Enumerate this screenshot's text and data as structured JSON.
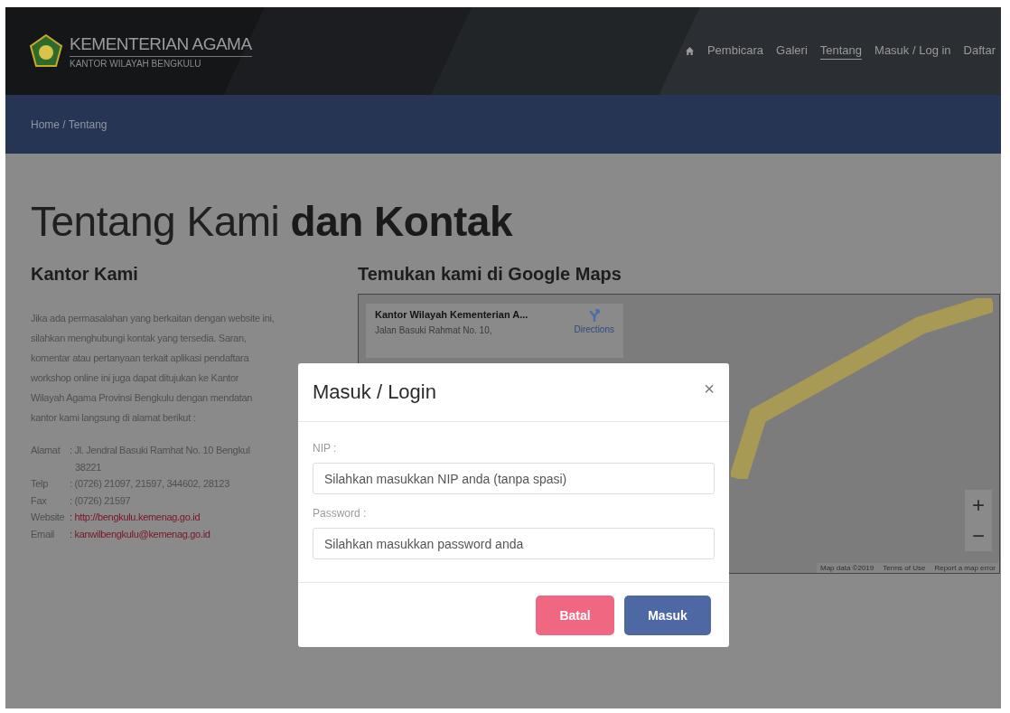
{
  "header": {
    "logo_title": "KEMENTERIAN AGAMA",
    "logo_subtitle": "KANTOR WILAYAH BENGKULU",
    "nav": [
      {
        "label": "Pembicara",
        "selected": false
      },
      {
        "label": "Galeri",
        "selected": false
      },
      {
        "label": "Tentang",
        "selected": true
      },
      {
        "label": "Masuk / Log in",
        "selected": false
      },
      {
        "label": "Daftar",
        "selected": false
      }
    ]
  },
  "breadcrumb": "Home / Tentang",
  "heading": "Tentang Kami **dan Kontak**",
  "office": {
    "title": "Kantor Kami",
    "paragraph_lines": [
      "Jika ada permasalahan yang berkaitan dengan website ini,",
      "silahkan menghubungi kontak yang tersedia. Saran,",
      "komentar atau pertanyaan terkait aplikasi pendaftara",
      "workshop online ini juga dapat ditujukan ke Kantor",
      "Wilayah Agama Provinsi Bengkulu dengan mendatan",
      "kantor kami langsung di alamat berikut :"
    ],
    "contacts": [
      {
        "label": "Alamat",
        "value": ": Jl. Jendral Basuki Ramhat No. 10 Bengkul",
        "value_2": "38221",
        "kind": "text"
      },
      {
        "label": "Telp",
        "value": ": (0726) 21097, 21597, 344602, 28123",
        "kind": "text"
      },
      {
        "label": "Fax",
        "value": ": (0726) 21597",
        "kind": "text"
      },
      {
        "label": "Website",
        "value": ": http://bengkulu.kemenag.go.id",
        "kind": "link"
      },
      {
        "label": "Email",
        "value": ": kanwilbengkulu@kemenag.go.id",
        "kind": "link"
      }
    ]
  },
  "map": {
    "title": "Temukan kami di Google Maps",
    "place_name": "Kantor Wilayah Kementerian A...",
    "place_address": "Jalan Basuki Rahmat No. 10,",
    "directions": "Directions",
    "zoom_in": "+",
    "zoom_out": "−",
    "footer": [
      "Map data ©2019",
      "Terms of Use",
      "Report a map error"
    ]
  },
  "modal": {
    "title": "Masuk / Login",
    "close": "×",
    "fields": [
      {
        "label": "NIP :",
        "placeholder": "Silahkan masukkan NIP anda (tanpa spasi)"
      },
      {
        "label": "Password :",
        "placeholder": "Silahkan masukkan password anda"
      }
    ],
    "buttons": [
      {
        "label": "Batal",
        "kind": "cancel"
      },
      {
        "label": "Masuk",
        "kind": "submit"
      }
    ]
  }
}
